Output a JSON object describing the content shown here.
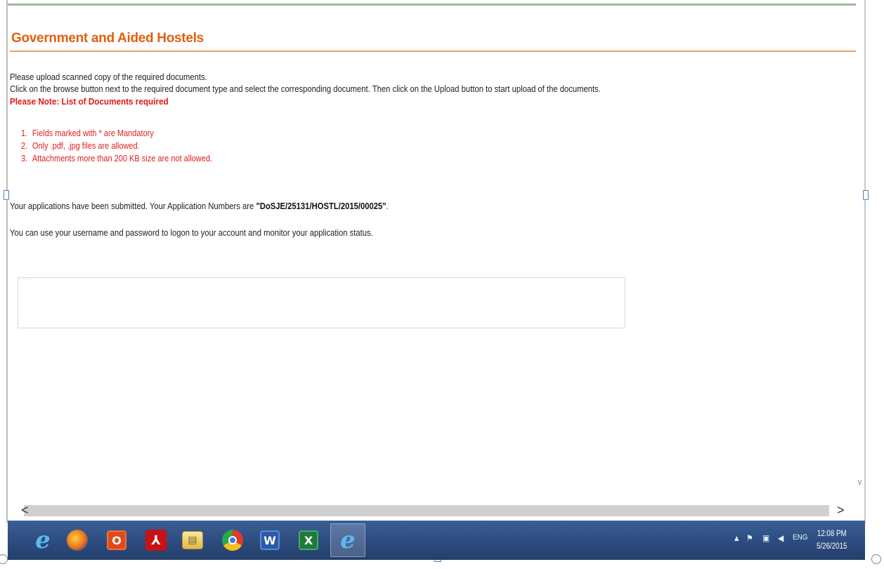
{
  "page": {
    "title": "Government and Aided Hostels",
    "instructions": [
      "Please upload scanned copy of the required documents.",
      "Click on the browse button next to the required document type and select the corresponding document. Then click on the Upload button to start upload of the documents."
    ],
    "note": "Please Note: List of Documents required",
    "rules": [
      {
        "num": "1.",
        "text": "Fields marked with * are Mandatory"
      },
      {
        "num": "2.",
        "text": "Only .pdf, .jpg files are allowed."
      },
      {
        "num": "3.",
        "text": "Attachments more than 200 KB size are not allowed."
      }
    ],
    "submitted_prefix": "Your applications have been submitted. Your Application Numbers are ",
    "application_number": "\"DoSJE/25131/HOSTL/2015/00025\"",
    "submitted_suffix": ".",
    "monitor_text": "You can use your username and password to logon to your account and monitor your application status."
  },
  "scroll": {
    "left_arrow": "<",
    "right_arrow": ">",
    "down_arrow": "∨"
  },
  "taskbar": {
    "apps": [
      {
        "name": "internet-explorer",
        "glyph": "e",
        "color": "#3aa0e8"
      },
      {
        "name": "firefox",
        "glyph": "●",
        "color": "#e8701a"
      },
      {
        "name": "office",
        "glyph": "O",
        "color": "#d84a1b"
      },
      {
        "name": "acrobat",
        "glyph": "⅄",
        "color": "#cc1010"
      },
      {
        "name": "file-explorer",
        "glyph": "▤",
        "color": "#e8c860"
      },
      {
        "name": "chrome",
        "glyph": "◉",
        "color": "#e0b020"
      },
      {
        "name": "word",
        "glyph": "W",
        "color": "#2b5aa8"
      },
      {
        "name": "excel",
        "glyph": "X",
        "color": "#1e7a3a"
      },
      {
        "name": "internet-explorer-active",
        "glyph": "e",
        "color": "#3aa0e8"
      }
    ],
    "tray": {
      "language": "ENG",
      "time": "12:08 PM",
      "date": "5/26/2015"
    }
  }
}
